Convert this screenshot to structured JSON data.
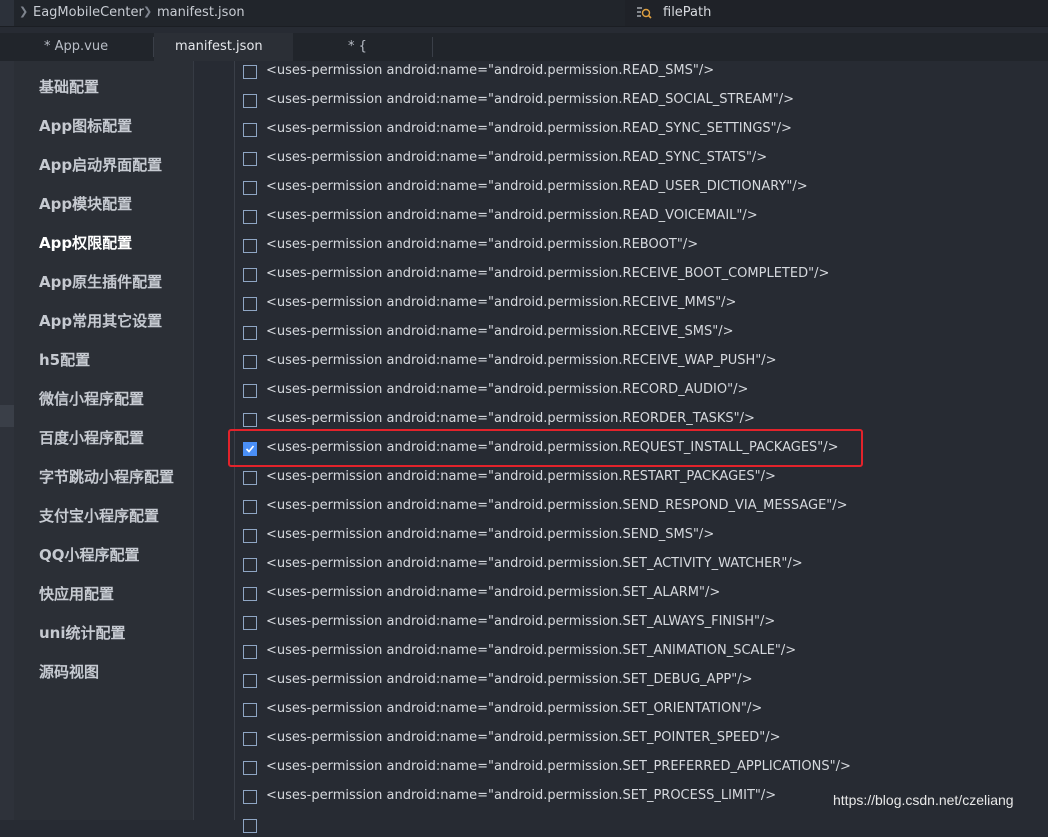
{
  "breadcrumb": {
    "project": "EagMobileCenter",
    "file": "manifest.json"
  },
  "search": {
    "value": "filePath"
  },
  "tabs": [
    {
      "label": "* App.vue"
    },
    {
      "label": "manifest.json"
    },
    {
      "label": "* {"
    }
  ],
  "sidebar": {
    "items": [
      {
        "label": "基础配置"
      },
      {
        "label": "App图标配置"
      },
      {
        "label": "App启动界面配置"
      },
      {
        "label": "App模块配置"
      },
      {
        "label": "App权限配置"
      },
      {
        "label": "App原生插件配置"
      },
      {
        "label": "App常用其它设置"
      },
      {
        "label": "h5配置"
      },
      {
        "label": "微信小程序配置"
      },
      {
        "label": "百度小程序配置"
      },
      {
        "label": "字节跳动小程序配置"
      },
      {
        "label": "支付宝小程序配置"
      },
      {
        "label": "QQ小程序配置"
      },
      {
        "label": "快应用配置"
      },
      {
        "label": "uni统计配置"
      },
      {
        "label": "源码视图"
      }
    ]
  },
  "permissions": [
    {
      "text": "<uses-permission android:name=\"android.permission.READ_SMS\"/>",
      "checked": false
    },
    {
      "text": "<uses-permission android:name=\"android.permission.READ_SOCIAL_STREAM\"/>",
      "checked": false
    },
    {
      "text": "<uses-permission android:name=\"android.permission.READ_SYNC_SETTINGS\"/>",
      "checked": false
    },
    {
      "text": "<uses-permission android:name=\"android.permission.READ_SYNC_STATS\"/>",
      "checked": false
    },
    {
      "text": "<uses-permission android:name=\"android.permission.READ_USER_DICTIONARY\"/>",
      "checked": false
    },
    {
      "text": "<uses-permission android:name=\"android.permission.READ_VOICEMAIL\"/>",
      "checked": false
    },
    {
      "text": "<uses-permission android:name=\"android.permission.REBOOT\"/>",
      "checked": false
    },
    {
      "text": "<uses-permission android:name=\"android.permission.RECEIVE_BOOT_COMPLETED\"/>",
      "checked": false
    },
    {
      "text": "<uses-permission android:name=\"android.permission.RECEIVE_MMS\"/>",
      "checked": false
    },
    {
      "text": "<uses-permission android:name=\"android.permission.RECEIVE_SMS\"/>",
      "checked": false
    },
    {
      "text": "<uses-permission android:name=\"android.permission.RECEIVE_WAP_PUSH\"/>",
      "checked": false
    },
    {
      "text": "<uses-permission android:name=\"android.permission.RECORD_AUDIO\"/>",
      "checked": false
    },
    {
      "text": "<uses-permission android:name=\"android.permission.REORDER_TASKS\"/>",
      "checked": false
    },
    {
      "text": "<uses-permission android:name=\"android.permission.REQUEST_INSTALL_PACKAGES\"/>",
      "checked": true
    },
    {
      "text": "<uses-permission android:name=\"android.permission.RESTART_PACKAGES\"/>",
      "checked": false
    },
    {
      "text": "<uses-permission android:name=\"android.permission.SEND_RESPOND_VIA_MESSAGE\"/>",
      "checked": false
    },
    {
      "text": "<uses-permission android:name=\"android.permission.SEND_SMS\"/>",
      "checked": false
    },
    {
      "text": "<uses-permission android:name=\"android.permission.SET_ACTIVITY_WATCHER\"/>",
      "checked": false
    },
    {
      "text": "<uses-permission android:name=\"android.permission.SET_ALARM\"/>",
      "checked": false
    },
    {
      "text": "<uses-permission android:name=\"android.permission.SET_ALWAYS_FINISH\"/>",
      "checked": false
    },
    {
      "text": "<uses-permission android:name=\"android.permission.SET_ANIMATION_SCALE\"/>",
      "checked": false
    },
    {
      "text": "<uses-permission android:name=\"android.permission.SET_DEBUG_APP\"/>",
      "checked": false
    },
    {
      "text": "<uses-permission android:name=\"android.permission.SET_ORIENTATION\"/>",
      "checked": false
    },
    {
      "text": "<uses-permission android:name=\"android.permission.SET_POINTER_SPEED\"/>",
      "checked": false
    },
    {
      "text": "<uses-permission android:name=\"android.permission.SET_PREFERRED_APPLICATIONS\"/>",
      "checked": false
    },
    {
      "text": "<uses-permission android:name=\"android.permission.SET_PROCESS_LIMIT\"/>",
      "checked": false
    }
  ],
  "watermark": "https://blog.csdn.net/czeliang",
  "colors": {
    "highlight_border": "#e3232b",
    "checkbox_checked": "#4a8ff7",
    "background": "#272b33"
  }
}
